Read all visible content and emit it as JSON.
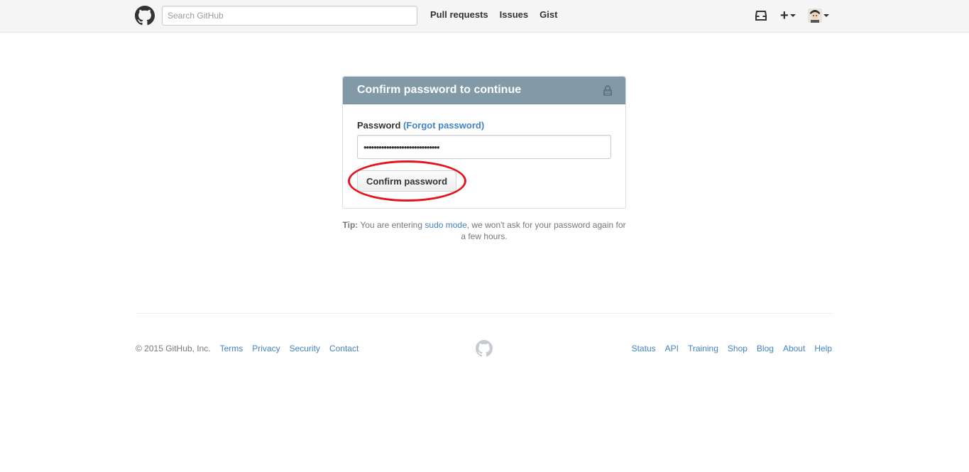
{
  "header": {
    "search_placeholder": "Search GitHub",
    "nav": [
      "Pull requests",
      "Issues",
      "Gist"
    ]
  },
  "auth": {
    "title": "Confirm password to continue",
    "password_label": "Password",
    "forgot_link": "(Forgot password)",
    "password_value": "••••••••••••••••••••••••••••••",
    "confirm_button": "Confirm password"
  },
  "tip": {
    "prefix": "Tip:",
    "text_before": "You are entering",
    "link": "sudo mode",
    "text_after": ", we won't ask for your password again for a few hours."
  },
  "footer": {
    "copyright": "© 2015 GitHub, Inc.",
    "left_links": [
      "Terms",
      "Privacy",
      "Security",
      "Contact"
    ],
    "right_links": [
      "Status",
      "API",
      "Training",
      "Shop",
      "Blog",
      "About",
      "Help"
    ]
  },
  "colors": {
    "header_bg": "#f5f5f5",
    "box_header_bg": "#829aa8",
    "link": "#4183c4",
    "annotation_circle": "#e4151c"
  },
  "icons": [
    "github-octocat-icon",
    "inbox-icon",
    "plus-icon",
    "avatar",
    "lock-icon"
  ]
}
